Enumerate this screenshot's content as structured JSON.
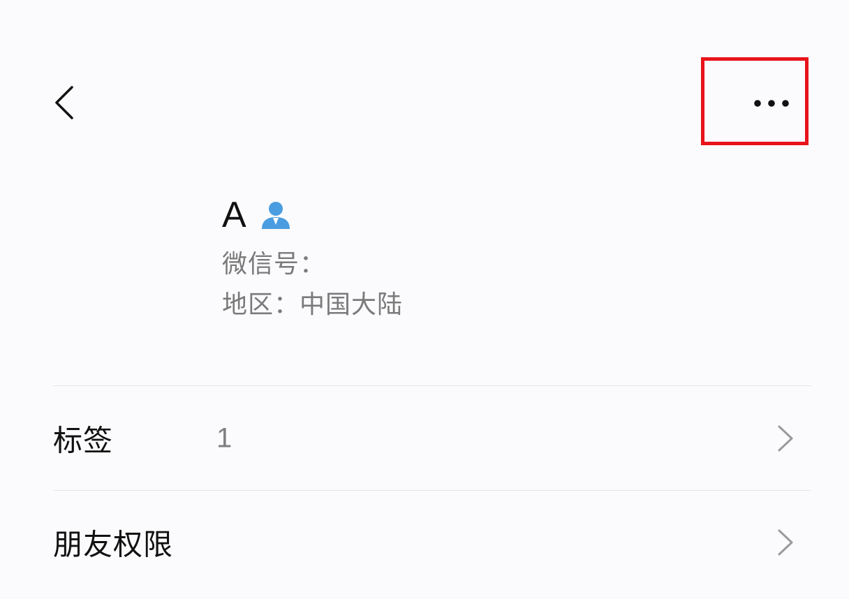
{
  "header": {
    "back_icon": "chevron-left-icon",
    "more_icon": "more-horizontal-icon",
    "highlight_color": "#e8131b"
  },
  "profile": {
    "name": "A",
    "name_icon": "person-icon",
    "name_icon_color": "#4a9de0",
    "wechat_id_label": "微信号：",
    "region": "地区：中国大陆"
  },
  "rows": [
    {
      "label": "标签",
      "value": "1",
      "icon": "chevron-right-icon"
    },
    {
      "label": "朋友权限",
      "value": "",
      "icon": "chevron-right-icon"
    }
  ]
}
